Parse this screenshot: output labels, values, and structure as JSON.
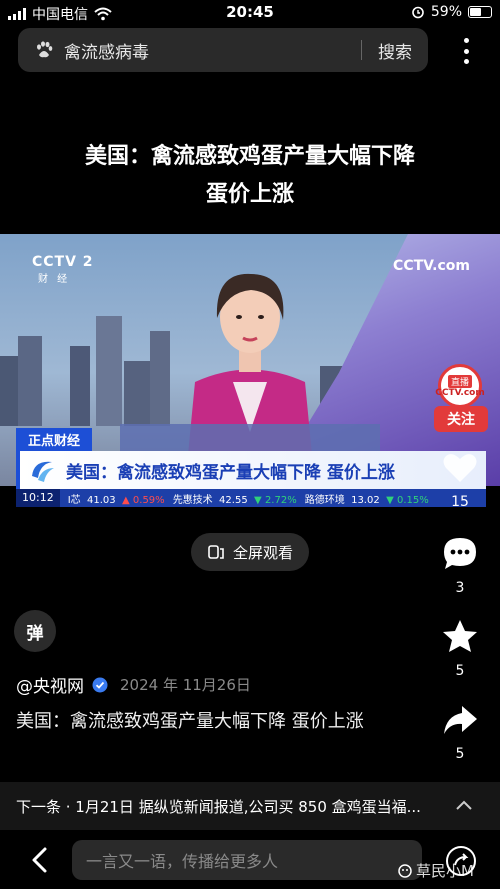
{
  "status_bar": {
    "carrier": "中国电信",
    "time": "20:45",
    "battery": "59%",
    "battery_level": 0.59
  },
  "search": {
    "query": "禽流感病毒",
    "button": "搜索"
  },
  "headline": {
    "line1": "美国：禽流感致鸡蛋产量大幅下降",
    "line2": "蛋价上涨"
  },
  "video": {
    "channel_logo": "CCTV 2",
    "channel_name": "财 经",
    "site_logo": "CCTV.com",
    "live_tag": "直播",
    "live_brand": "CCTV.com",
    "follow_label": "关注",
    "program_tag": "正点财经",
    "lower_third": "美国：禽流感致鸡蛋产量大幅下降  蛋价上涨",
    "ticker_time": "10:12",
    "ticker": [
      {
        "name": "I芯",
        "price": "41.03",
        "arrow": "▲",
        "change": "0.59%",
        "dir": "up"
      },
      {
        "name": "先惠技术",
        "price": "42.55",
        "arrow": "▼",
        "change": "2.72%",
        "dir": "down"
      },
      {
        "name": "路德环境",
        "price": "13.02",
        "arrow": "▼",
        "change": "0.15%",
        "dir": "down"
      }
    ]
  },
  "fullscreen_label": "全屏观看",
  "actions": {
    "likes": "15",
    "comments": "3",
    "favorites": "5",
    "shares": "5"
  },
  "danmu_label": "弹",
  "post": {
    "author": "@央视网",
    "date": "2024 年 11月26日",
    "desc": "美国：禽流感致鸡蛋产量大幅下降   蛋价上涨"
  },
  "next": {
    "text": "下一条 · 1月21日 据纵览新闻报道,公司买 850 盒鸡蛋当福..."
  },
  "comment_placeholder": "一言又一语，传播给更多人",
  "watermark": "草民小M",
  "colors": {
    "background": "#000000",
    "accent_red": "#e23a3a",
    "program_blue": "#1d4fd6"
  }
}
